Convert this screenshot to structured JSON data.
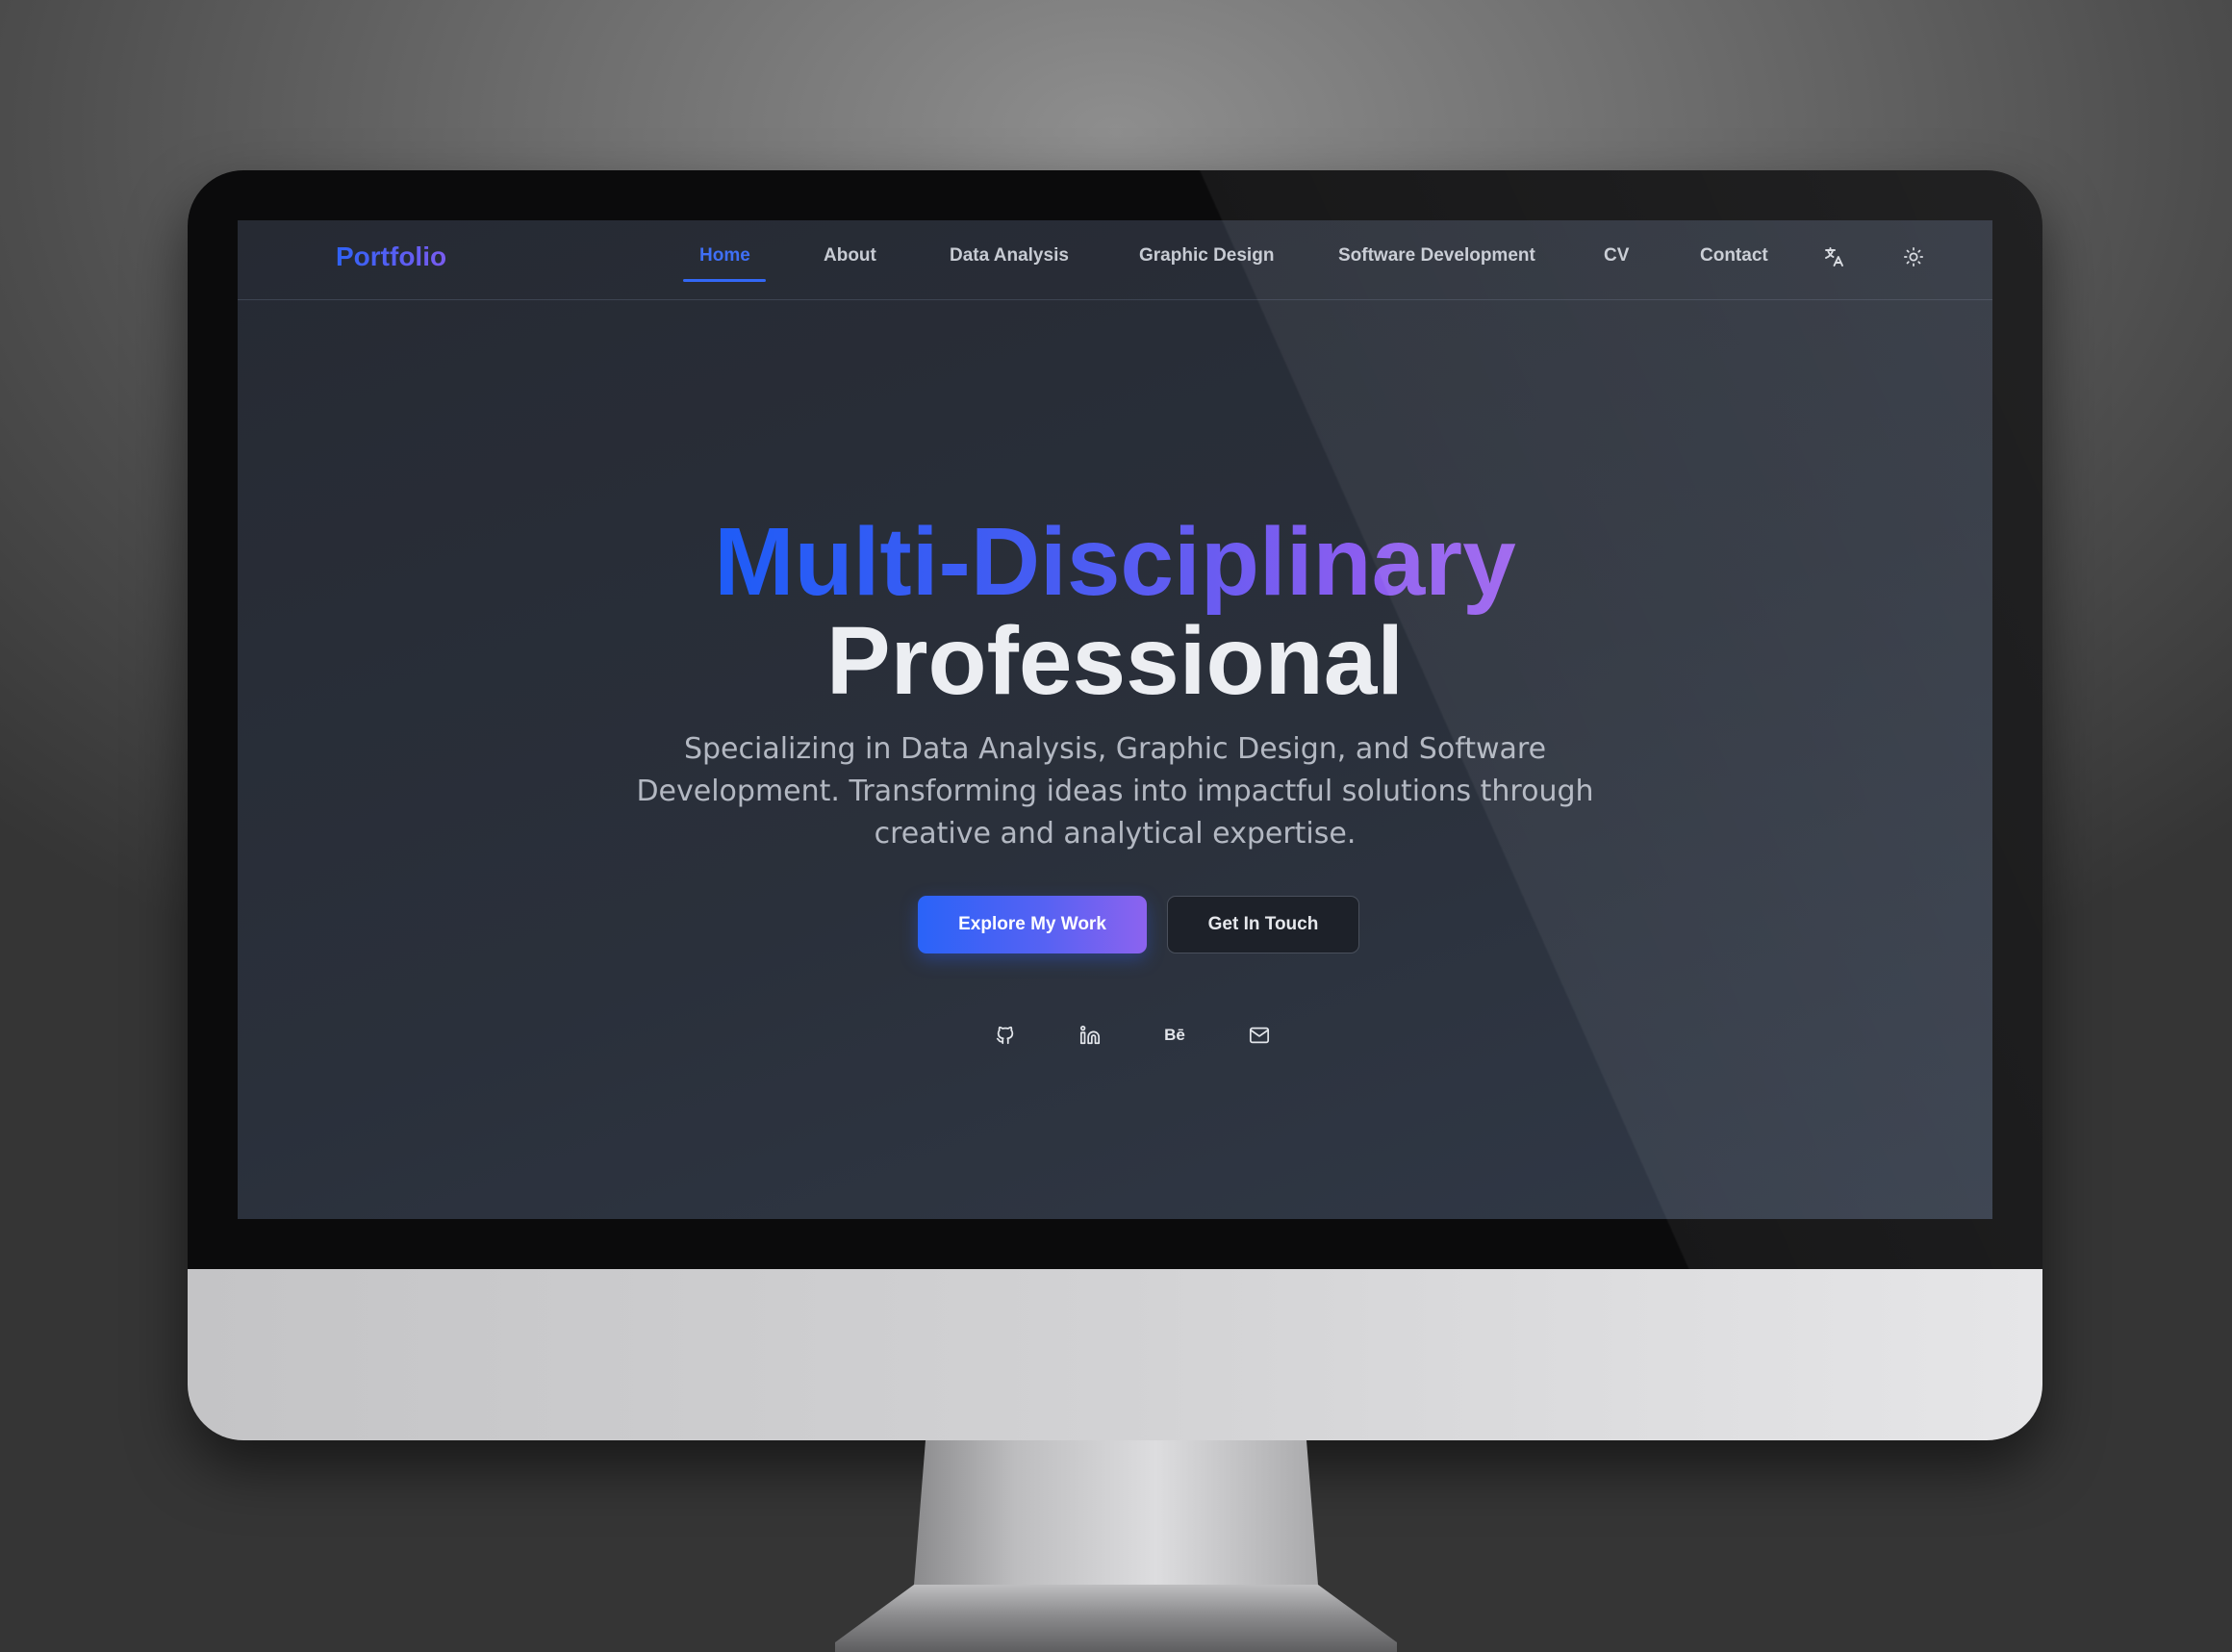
{
  "nav": {
    "brand": "Portfolio",
    "items": [
      {
        "label": "Home",
        "active": true
      },
      {
        "label": "About"
      },
      {
        "label": "Data Analysis"
      },
      {
        "label": "Graphic Design"
      },
      {
        "label": "Software Development"
      },
      {
        "label": "CV"
      },
      {
        "label": "Contact"
      }
    ],
    "icons": [
      "translate-icon",
      "sun-icon"
    ]
  },
  "hero": {
    "title_line1": "Multi-Disciplinary",
    "title_line2": "Professional",
    "description": "Specializing in Data Analysis, Graphic Design, and Software Development. Transforming ideas into impactful solutions through creative and analytical expertise.",
    "primary_button": "Explore My Work",
    "secondary_button": "Get In Touch"
  },
  "social": {
    "icons": [
      "github-icon",
      "linkedin-icon",
      "behance-icon",
      "mail-icon"
    ],
    "behance_glyph": "Bē"
  },
  "colors": {
    "accent_blue": "#2a63f8",
    "accent_purple": "#8c63ef",
    "background": "#282d37"
  }
}
